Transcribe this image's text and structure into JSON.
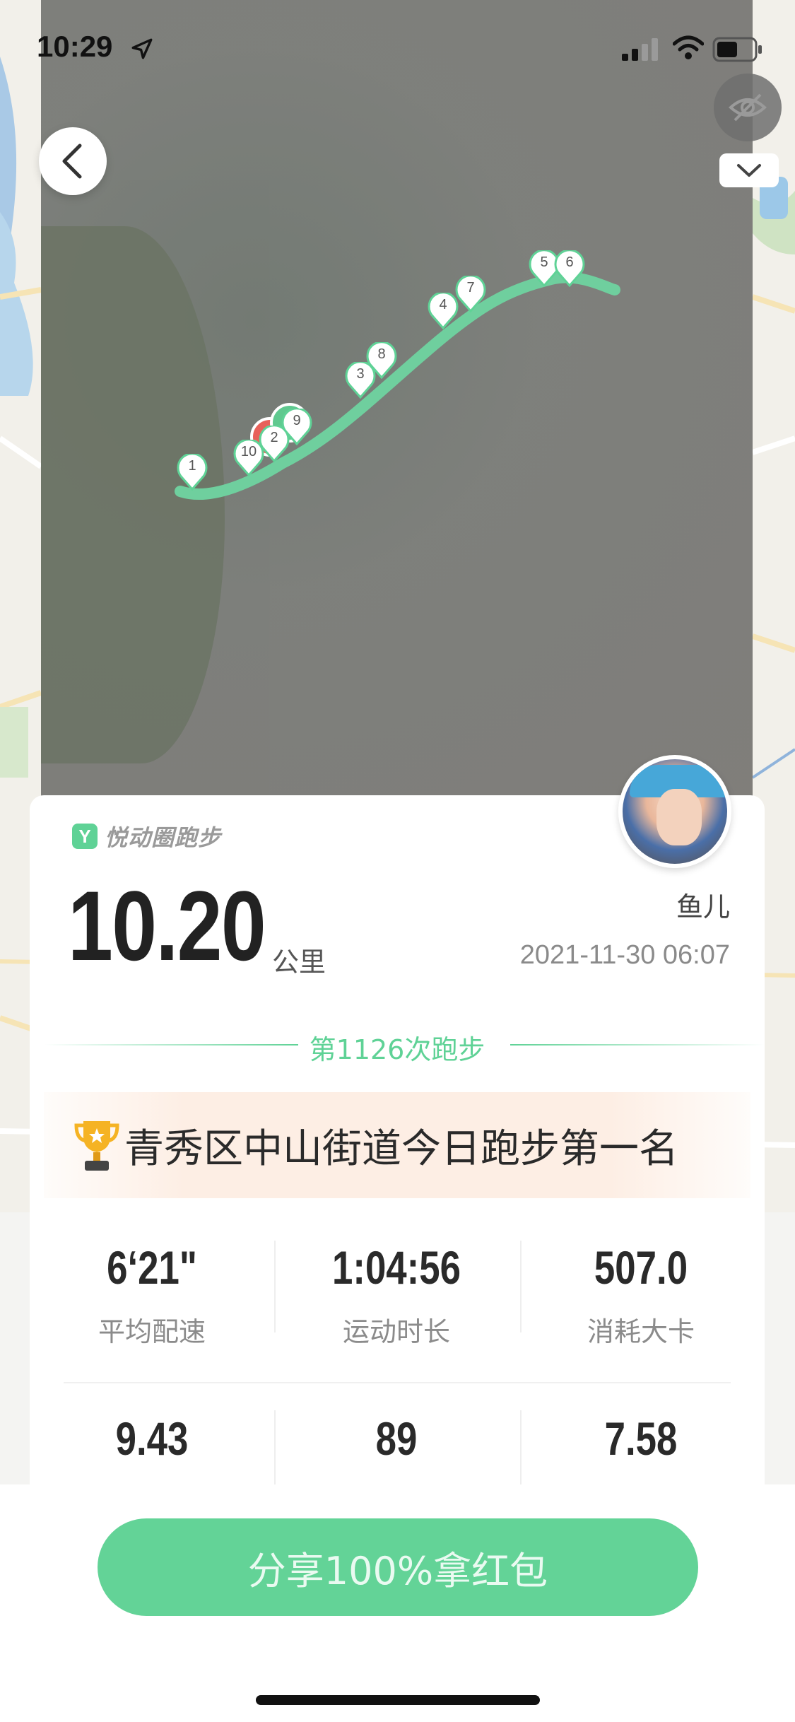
{
  "status_bar": {
    "time": "10:29"
  },
  "map": {
    "markers": [
      "1",
      "2",
      "3",
      "4",
      "5",
      "6",
      "7",
      "8",
      "9",
      "10"
    ]
  },
  "summary": {
    "app_name": "悦动圈跑步",
    "logo_letter": "Y",
    "distance": "10.20",
    "unit": "公里",
    "username": "鱼儿",
    "datetime": "2021-11-30 06:07",
    "run_count": "第1126次跑步",
    "rank": "青秀区中山街道今日跑步第一名"
  },
  "stats": {
    "row1": [
      {
        "value": "6‘21\"",
        "label": "平均配速"
      },
      {
        "value": "1:04:56",
        "label": "运动时长"
      },
      {
        "value": "507.0",
        "label": "消耗大卡"
      }
    ],
    "row2": [
      {
        "value": "9.43"
      },
      {
        "value": "89"
      },
      {
        "value": "7.58"
      }
    ]
  },
  "share_button": "分享100%拿红包",
  "colors": {
    "accent": "#5fd296",
    "share_button": "#63d397",
    "route": "#6fcf9e"
  }
}
